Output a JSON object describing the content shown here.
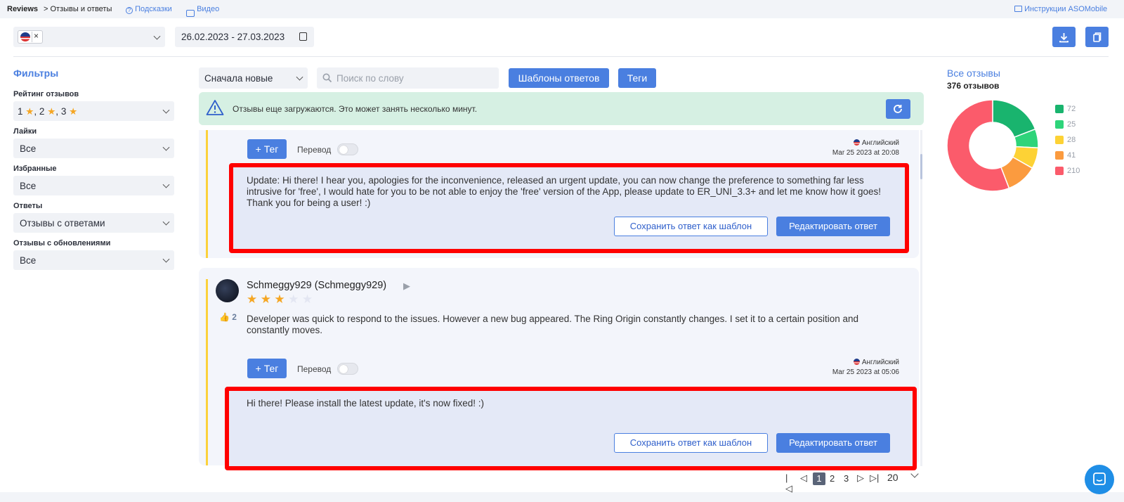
{
  "topbar": {
    "root": "Reviews",
    "crumb": "> Отзывы и ответы",
    "hints": "Подсказки",
    "video": "Видео",
    "instructions": "Инструкции ASOMobile"
  },
  "toolbar": {
    "country_remove": "×",
    "date_range": "26.02.2023 - 27.03.2023"
  },
  "filters": {
    "title": "Фильтры",
    "rating_label": "Рейтинг отзывов",
    "rating_values": [
      "1",
      "2",
      "3"
    ],
    "likes_label": "Лайки",
    "likes_value": "Все",
    "fav_label": "Избранные",
    "fav_value": "Все",
    "answers_label": "Ответы",
    "answers_value": "Отзывы с ответами",
    "updates_label": "Отзывы с обновлениями",
    "updates_value": "Все"
  },
  "list_controls": {
    "sort_value": "Сначала новые",
    "search_placeholder": "Поиск по слову",
    "templates_button": "Шаблоны ответов",
    "tags_button": "Теги"
  },
  "notice": {
    "text": "Отзывы еще загружаются. Это может занять несколько минут."
  },
  "reviews": [
    {
      "tag_button": "+ Тег",
      "translate_label": "Перевод",
      "language": "Английский",
      "date": "Mar 25 2023 at 20:08",
      "reply_text": "Update: Hi there! I hear you, apologies for the inconvenience, released an urgent update, you can now change the preference to something far less intrusive for 'free', I would hate for you to be not able to enjoy the 'free' version of the App, please update to ER_UNI_3.3+ and let me know how it goes! Thank you for being a user! :)",
      "save_template": "Сохранить ответ как шаблон",
      "edit_reply": "Редактировать ответ"
    },
    {
      "author": "Schmeggy929 (Schmeggy929)",
      "rating": 3,
      "likes": "2",
      "text": "Developer was quick to respond to the issues. However a new bug appeared. The Ring Origin constantly changes. I set it to a certain position and constantly moves.",
      "tag_button": "+ Тег",
      "translate_label": "Перевод",
      "language": "Английский",
      "date": "Mar 25 2023 at 05:06",
      "reply_text": "Hi there! Please install the latest update, it's now fixed! :)",
      "save_template": "Сохранить ответ как шаблон",
      "edit_reply": "Редактировать ответ"
    }
  ],
  "pagination": {
    "pages": [
      "1",
      "2",
      "3"
    ],
    "per_page": "20"
  },
  "summary": {
    "title": "Все отзывы",
    "count": "376 отзывов",
    "colors": [
      "#19b46e",
      "#2ed47a",
      "#fdd235",
      "#fb9b3f",
      "#fb5b6b"
    ]
  },
  "chart_data": {
    "type": "pie",
    "title": "",
    "categories": [
      "",
      "",
      "",
      "",
      ""
    ],
    "values": [
      72,
      25,
      28,
      41,
      210
    ],
    "series": [
      {
        "values": [
          72,
          25,
          28,
          41,
          210
        ]
      }
    ]
  }
}
